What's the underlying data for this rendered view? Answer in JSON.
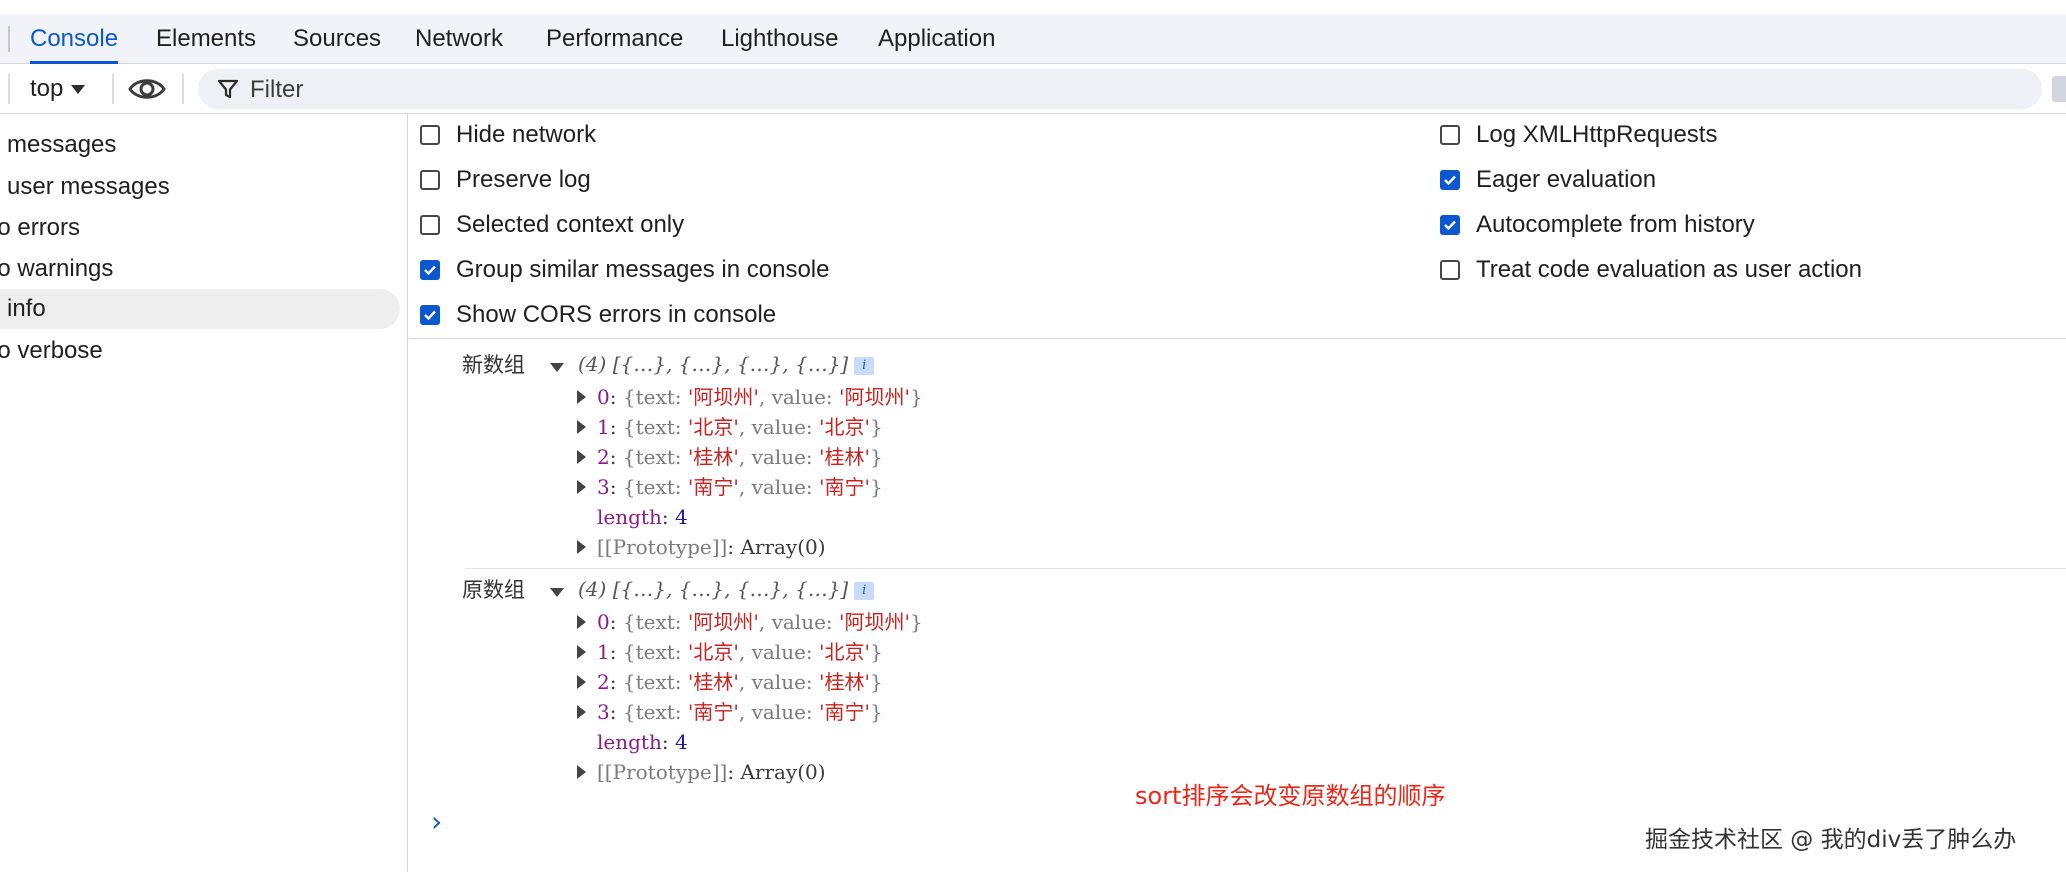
{
  "tabs": [
    {
      "label": "Console",
      "active": true
    },
    {
      "label": "Elements",
      "active": false
    },
    {
      "label": "Sources",
      "active": false
    },
    {
      "label": "Network",
      "active": false
    },
    {
      "label": "Performance",
      "active": false
    },
    {
      "label": "Lighthouse",
      "active": false
    },
    {
      "label": "Application",
      "active": false
    }
  ],
  "toolbar": {
    "context_label": "top",
    "eye_icon": "eye-icon",
    "filter_placeholder": "Filter"
  },
  "sidebar": {
    "items": [
      {
        "label": "messages"
      },
      {
        "label": "user messages"
      },
      {
        "label": "lo errors"
      },
      {
        "label": "lo warnings"
      },
      {
        "label": "info",
        "selected": true
      },
      {
        "label": "lo verbose"
      }
    ]
  },
  "settings": {
    "left": [
      {
        "label": "Hide network",
        "checked": false
      },
      {
        "label": "Preserve log",
        "checked": false
      },
      {
        "label": "Selected context only",
        "checked": false
      },
      {
        "label": "Group similar messages in console",
        "checked": true
      },
      {
        "label": "Show CORS errors in console",
        "checked": true
      }
    ],
    "right": [
      {
        "label": "Log XMLHttpRequests",
        "checked": false
      },
      {
        "label": "Eager evaluation",
        "checked": true
      },
      {
        "label": "Autocomplete from history",
        "checked": true
      },
      {
        "label": "Treat code evaluation as user action",
        "checked": false
      }
    ]
  },
  "console": {
    "groups": [
      {
        "label": "新数组",
        "summary": "(4)  [{…},  {…},  {…},  {…}]",
        "badge": "i",
        "entries": [
          {
            "index": "0",
            "text": "阿坝州",
            "value": "阿坝州"
          },
          {
            "index": "1",
            "text": "北京",
            "value": "北京"
          },
          {
            "index": "2",
            "text": "桂林",
            "value": "桂林"
          },
          {
            "index": "3",
            "text": "南宁",
            "value": "南宁"
          }
        ],
        "length_key": "length",
        "length_value": "4",
        "prototype_key": "[[Prototype]]",
        "prototype_value": "Array(0)"
      },
      {
        "label": "原数组",
        "summary": "(4)  [{…},  {…},  {…},  {…}]",
        "badge": "i",
        "entries": [
          {
            "index": "0",
            "text": "阿坝州",
            "value": "阿坝州"
          },
          {
            "index": "1",
            "text": "北京",
            "value": "北京"
          },
          {
            "index": "2",
            "text": "桂林",
            "value": "桂林"
          },
          {
            "index": "3",
            "text": "南宁",
            "value": "南宁"
          }
        ],
        "length_key": "length",
        "length_value": "4",
        "prototype_key": "[[Prototype]]",
        "prototype_value": "Array(0)"
      }
    ],
    "prompt": "›",
    "annotation": "sort排序会改变原数组的顺序"
  },
  "watermark": "掘金技术社区 @ 我的div丢了肿么办"
}
